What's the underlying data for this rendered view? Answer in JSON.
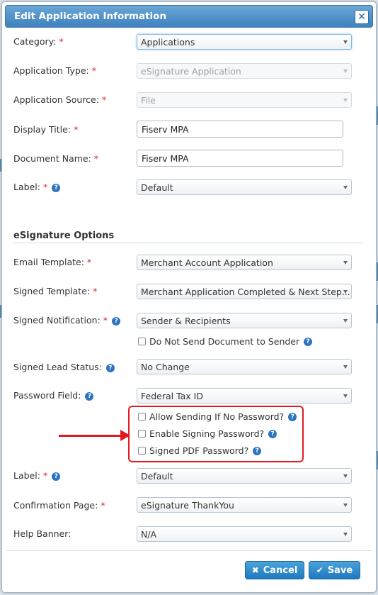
{
  "dialog": {
    "title": "Edit Application Information"
  },
  "fields": {
    "category": {
      "label": "Category:",
      "value": "Applications"
    },
    "application_type": {
      "label": "Application Type:",
      "value": "eSignature Application"
    },
    "application_source": {
      "label": "Application Source:",
      "value": "File"
    },
    "display_title": {
      "label": "Display Title:",
      "value": "Fiserv MPA"
    },
    "document_name": {
      "label": "Document Name:",
      "value": "Fiserv MPA"
    },
    "label1": {
      "label": "Label:",
      "value": "Default"
    }
  },
  "esignature": {
    "section_title": "eSignature Options",
    "email_template": {
      "label": "Email Template:",
      "value": "Merchant Account Application"
    },
    "signed_template": {
      "label": "Signed Template:",
      "value": "Merchant Application Completed & Next Step..."
    },
    "signed_notification": {
      "label": "Signed Notification:",
      "value": "Sender & Recipients"
    },
    "do_not_send": {
      "label": "Do Not Send Document to Sender"
    },
    "signed_lead_status": {
      "label": "Signed Lead Status:",
      "value": "No Change"
    },
    "password_field": {
      "label": "Password Field:",
      "value": "Federal Tax ID"
    },
    "allow_sending": {
      "label": "Allow Sending If No Password?"
    },
    "enable_signing_password": {
      "label": "Enable Signing Password?"
    },
    "signed_pdf_password": {
      "label": "Signed PDF Password?"
    },
    "label2": {
      "label": "Label:",
      "value": "Default"
    },
    "confirmation_page": {
      "label": "Confirmation Page:",
      "value": "eSignature ThankYou"
    },
    "help_banner": {
      "label": "Help Banner:",
      "value": "N/A"
    }
  },
  "required_marker": "*",
  "help_glyph": "?",
  "buttons": {
    "cancel": "Cancel",
    "save": "Save"
  },
  "colors": {
    "accent": "#3f81bf",
    "required": "#d9232d",
    "annotation": "#e11b22"
  }
}
